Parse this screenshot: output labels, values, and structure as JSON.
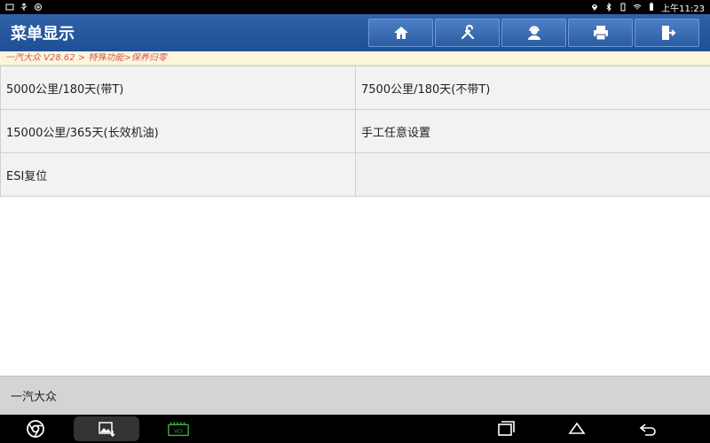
{
  "status_bar": {
    "time": "上午11:23"
  },
  "header": {
    "title": "菜单显示"
  },
  "toolbar": {
    "buttons": [
      {
        "name": "home-button",
        "icon": "home-icon"
      },
      {
        "name": "diagnose-button",
        "icon": "tools-icon"
      },
      {
        "name": "help-button",
        "icon": "support-icon"
      },
      {
        "name": "print-button",
        "icon": "printer-icon"
      },
      {
        "name": "exit-button",
        "icon": "exit-icon"
      }
    ]
  },
  "breadcrumb": {
    "text": "一汽大众 V28.62 > 特殊功能>保养归零"
  },
  "menu": {
    "items": [
      {
        "label": "5000公里/180天(带T)"
      },
      {
        "label": "7500公里/180天(不带T)"
      },
      {
        "label": "15000公里/365天(长效机油)"
      },
      {
        "label": "手工任意设置"
      },
      {
        "label": "ESI复位"
      },
      {
        "label": ""
      }
    ]
  },
  "footer": {
    "text": "一汽大众"
  },
  "nav": {
    "vci_label": "VCI"
  },
  "colors": {
    "header_blue": "#2f62a8",
    "breadcrumb_text": "#d9534f",
    "breadcrumb_bg": "#fdf6dc",
    "vci_green": "#3fae3f"
  }
}
